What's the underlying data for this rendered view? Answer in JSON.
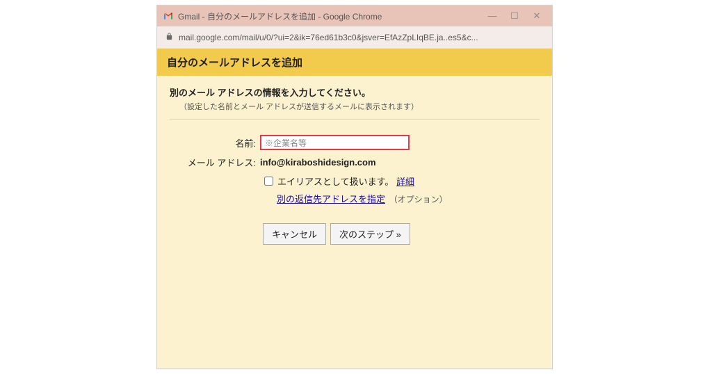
{
  "window": {
    "title": "Gmail - 自分のメールアドレスを追加 - Google Chrome"
  },
  "addressbar": {
    "url": "mail.google.com/mail/u/0/?ui=2&ik=76ed61b3c0&jsver=EfAzZpLIqBE.ja..es5&c..."
  },
  "header": {
    "title": "自分のメールアドレスを追加"
  },
  "section": {
    "title": "別のメール アドレスの情報を入力してください。",
    "subtitle": "（設定した名前とメール アドレスが送信するメールに表示されます）"
  },
  "form": {
    "name_label": "名前:",
    "name_value": "※企業名等",
    "email_label": "メール アドレス:",
    "email_value": "info@kiraboshidesign.com",
    "alias_label": "エイリアスとして扱います。",
    "alias_detail_link": "詳細",
    "reply_link": "別の返信先アドレスを指定",
    "reply_option": "（オプション）"
  },
  "buttons": {
    "cancel": "キャンセル",
    "next": "次のステップ »"
  }
}
